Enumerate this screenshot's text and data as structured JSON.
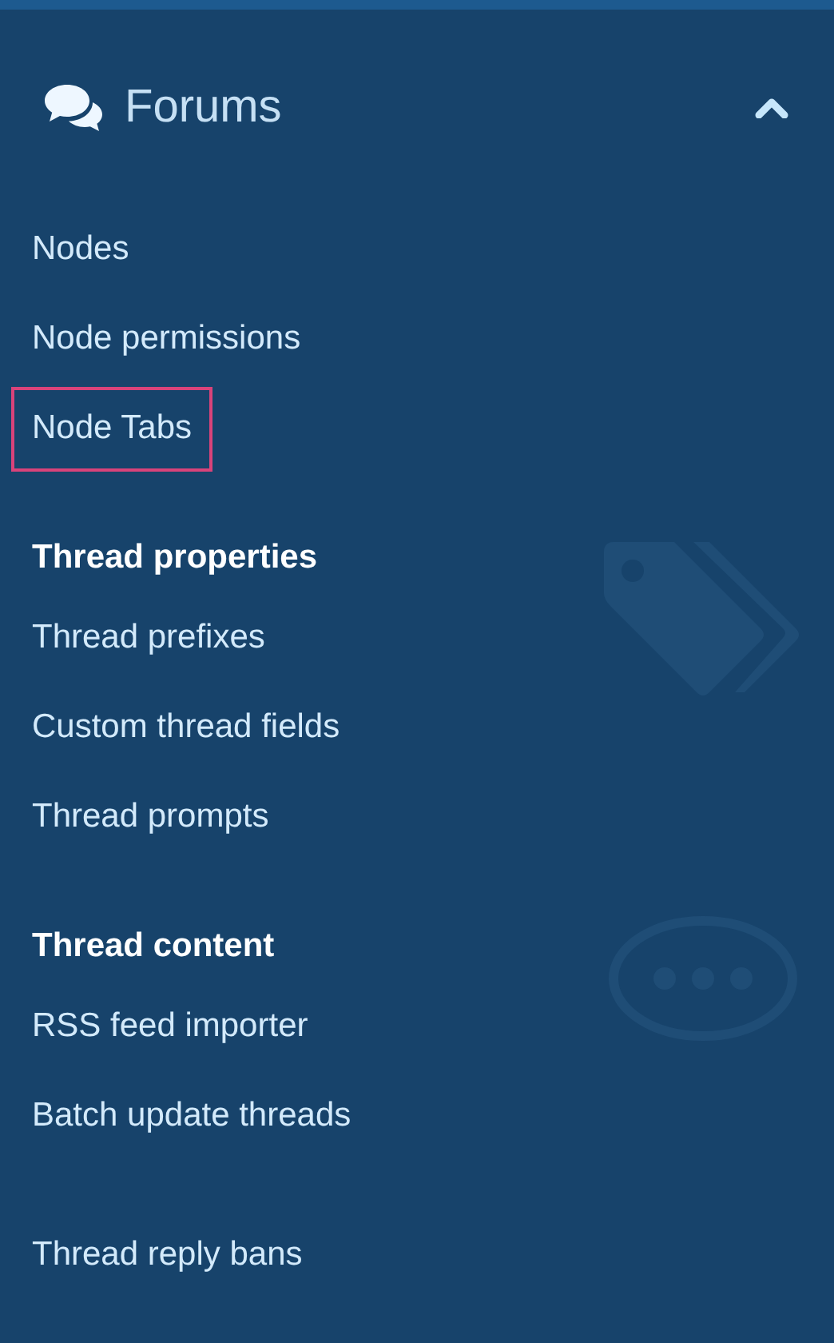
{
  "header": {
    "title": "Forums",
    "expanded": true
  },
  "sections": [
    {
      "items": [
        {
          "label": "Nodes",
          "highlighted": false
        },
        {
          "label": "Node permissions",
          "highlighted": false
        },
        {
          "label": "Node Tabs",
          "highlighted": true
        }
      ]
    },
    {
      "heading": "Thread properties",
      "items": [
        {
          "label": "Thread prefixes",
          "highlighted": false
        },
        {
          "label": "Custom thread fields",
          "highlighted": false
        },
        {
          "label": "Thread prompts",
          "highlighted": false
        }
      ]
    },
    {
      "heading": "Thread content",
      "items": [
        {
          "label": "RSS feed importer",
          "highlighted": false
        },
        {
          "label": "Batch update threads",
          "highlighted": false
        }
      ]
    },
    {
      "items": [
        {
          "label": "Thread reply bans",
          "highlighted": false
        }
      ]
    }
  ]
}
